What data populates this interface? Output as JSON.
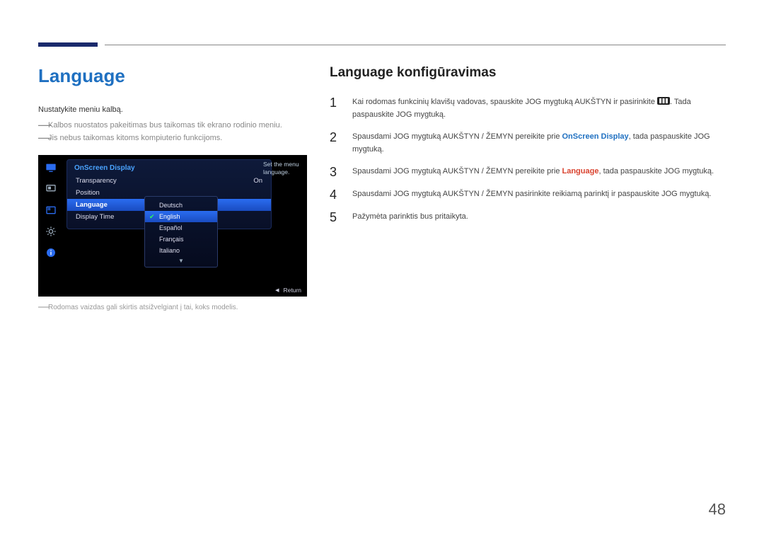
{
  "page_number": "48",
  "left": {
    "heading": "Language",
    "desc": "Nustatykite meniu kalbą.",
    "notes": [
      "Kalbos nuostatos pakeitimas bus taikomas tik ekrano rodinio meniu.",
      "Jis nebus taikomas kitoms kompiuterio funkcijoms."
    ],
    "footnote": "Rodomas vaizdas gali skirtis atsižvelgiant į tai, koks modelis."
  },
  "osd": {
    "panel_title": "OnScreen Display",
    "help_text": "Set the menu language.",
    "rows": [
      {
        "label": "Transparency",
        "value": "On",
        "active": false
      },
      {
        "label": "Position",
        "value": "",
        "active": false
      },
      {
        "label": "Language",
        "value": "",
        "active": true
      },
      {
        "label": "Display Time",
        "value": "",
        "active": false
      }
    ],
    "options": [
      "Deutsch",
      "English",
      "Español",
      "Français",
      "Italiano"
    ],
    "selected_option": "English",
    "return_label": "Return"
  },
  "right": {
    "heading": "Language konfigūravimas",
    "steps": [
      {
        "num": "1",
        "segments": [
          {
            "t": "Kai rodomas funkcinių klavišų vadovas, spauskite JOG mygtuką AUKŠTYN ir pasirinkite "
          },
          {
            "icon": "func"
          },
          {
            "t": ". Tada paspauskite JOG mygtuką."
          }
        ]
      },
      {
        "num": "2",
        "segments": [
          {
            "t": "Spausdami JOG mygtuką AUKŠTYN / ŽEMYN pereikite prie "
          },
          {
            "t": "OnScreen Display",
            "cls": "em-blue"
          },
          {
            "t": ", tada paspauskite JOG mygtuką."
          }
        ]
      },
      {
        "num": "3",
        "segments": [
          {
            "t": "Spausdami JOG mygtuką AUKŠTYN / ŽEMYN pereikite prie "
          },
          {
            "t": "Language",
            "cls": "em-red"
          },
          {
            "t": ", tada paspauskite JOG mygtuką."
          }
        ]
      },
      {
        "num": "4",
        "segments": [
          {
            "t": "Spausdami JOG mygtuką AUKŠTYN / ŽEMYN pasirinkite reikiamą parinktį ir paspauskite JOG mygtuką."
          }
        ]
      },
      {
        "num": "5",
        "segments": [
          {
            "t": "Pažymėta parinktis bus pritaikyta."
          }
        ]
      }
    ]
  }
}
